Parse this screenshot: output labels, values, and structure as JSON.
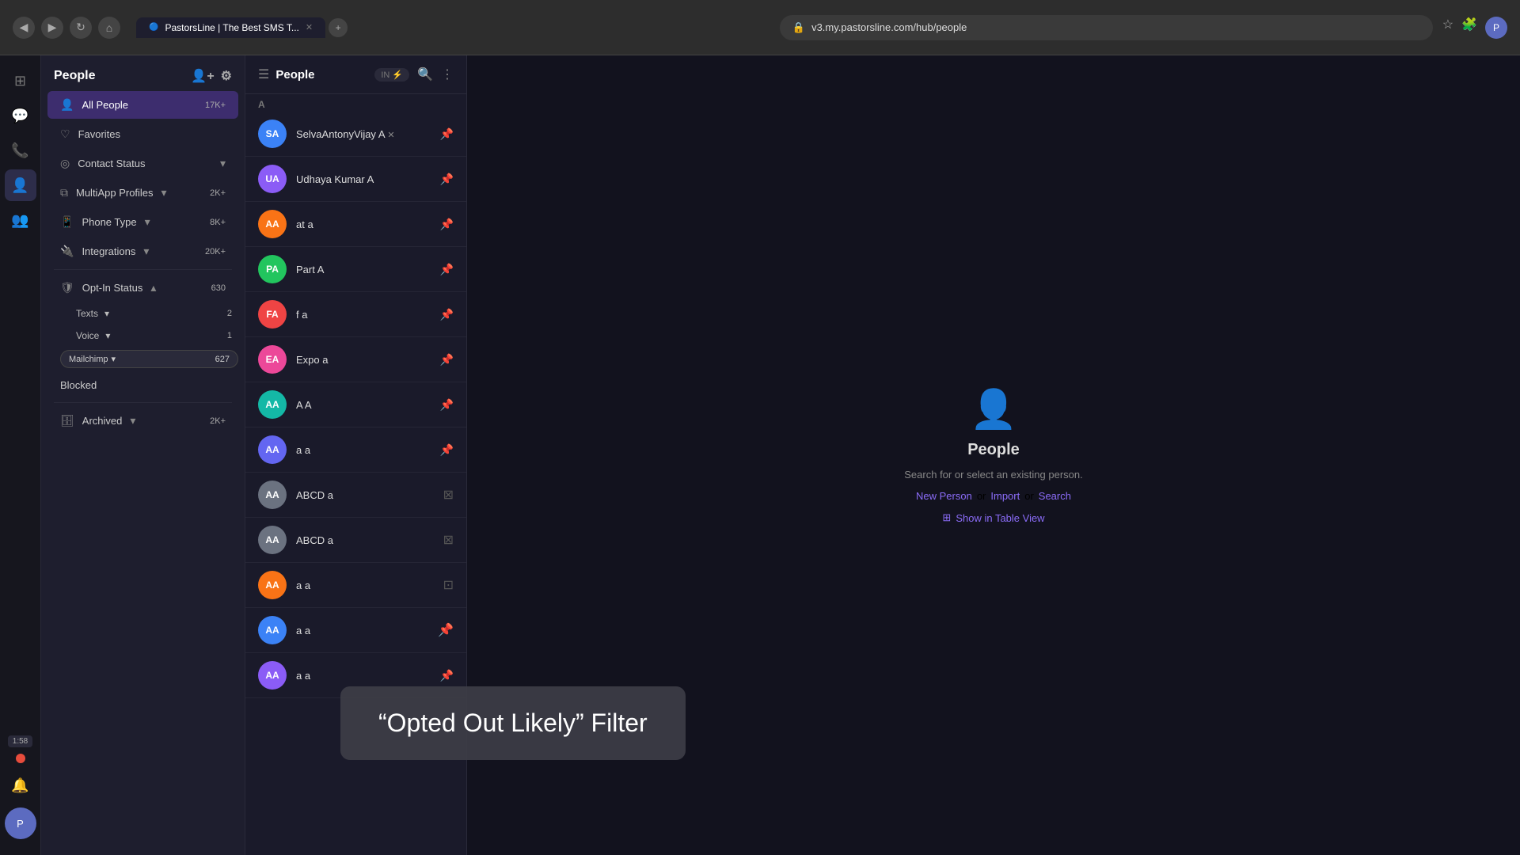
{
  "browser": {
    "url": "v3.my.pastorsline.com/hub/people",
    "tab_label": "PastorsLine | The Best SMS T...",
    "back_icon": "◀",
    "forward_icon": "▶",
    "refresh_icon": "↻"
  },
  "time": "1:58",
  "sidebar": {
    "title": "People",
    "all_people_label": "All People",
    "all_people_count": "17K+",
    "favorites_label": "Favorites",
    "contact_status_label": "Contact Status",
    "multi_app_label": "MultiApp Profiles",
    "multi_app_count": "2K+",
    "phone_type_label": "Phone Type",
    "phone_type_count": "8K+",
    "integrations_label": "Integrations",
    "integrations_count": "20K+",
    "opt_in_label": "Opt-In Status",
    "opt_in_count": "630",
    "texts_label": "Texts",
    "texts_count": "2",
    "voice_label": "Voice",
    "voice_count": "1",
    "mailchimp_label": "Mailchimp",
    "mailchimp_count": "627",
    "blocked_label": "Blocked",
    "archived_label": "Archived",
    "archived_count": "2K+"
  },
  "people_header": {
    "title": "People",
    "add_person_icon": "add-person"
  },
  "people_list": {
    "section_a": "A",
    "items": [
      {
        "initials": "SA",
        "name": "SelvaAntonyVijay A",
        "color": "av-blue",
        "has_tag": true
      },
      {
        "initials": "UA",
        "name": "Udhaya Kumar A",
        "color": "av-purple",
        "has_tag": false
      },
      {
        "initials": "AA",
        "name": "at a",
        "color": "av-orange",
        "has_tag": false
      },
      {
        "initials": "PA",
        "name": "Part A",
        "color": "av-green",
        "has_tag": false
      },
      {
        "initials": "FA",
        "name": "f a",
        "color": "av-red",
        "has_tag": false
      },
      {
        "initials": "EA",
        "name": "Expo a",
        "color": "av-pink",
        "has_tag": false
      },
      {
        "initials": "AA",
        "name": "A A",
        "color": "av-teal",
        "has_tag": false
      },
      {
        "initials": "AA",
        "name": "a a",
        "color": "av-indigo",
        "has_tag": false
      },
      {
        "initials": "AA",
        "name": "ABCD a",
        "color": "av-gray",
        "has_tag": false
      },
      {
        "initials": "AA",
        "name": "ABCD a",
        "color": "av-gray",
        "has_tag": false
      },
      {
        "initials": "AA",
        "name": "a a",
        "color": "av-orange",
        "has_tag": false
      },
      {
        "initials": "AA",
        "name": "a a",
        "color": "av-blue",
        "has_tag": false
      },
      {
        "initials": "AA",
        "name": "a a",
        "color": "av-purple",
        "has_tag": false
      }
    ]
  },
  "empty_state": {
    "title": "People",
    "description": "Search for or select an existing person.",
    "new_person": "New Person",
    "or_import": "or",
    "import": "Import",
    "search": "Search",
    "table_view": "Show in Table View"
  },
  "tooltip": {
    "text": "“Opted Out Likely” Filter"
  },
  "icons": {
    "grid": "⊞",
    "chat": "💬",
    "phone": "📞",
    "person": "👤",
    "people": "👥",
    "search": "🔍",
    "settings": "⚙",
    "add": "+",
    "more": "⋮",
    "heart": "♡",
    "shield": "🛡",
    "archive": "🗄",
    "chevron_down": "▾",
    "chevron_up": "▴",
    "plug": "🔌",
    "phone_filter": "📱",
    "layers": "⧉",
    "bell": "🔔"
  }
}
